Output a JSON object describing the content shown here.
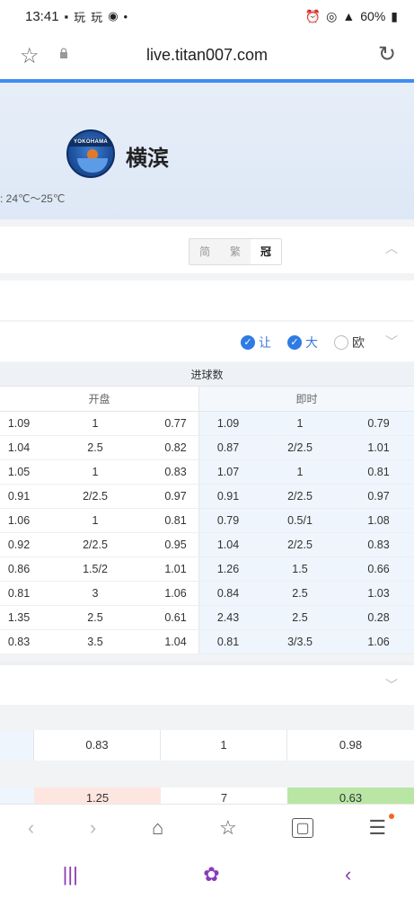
{
  "status": {
    "time": "13:41",
    "left_icons": [
      "■",
      "玩",
      "玩",
      "●",
      "•"
    ],
    "battery": "60%"
  },
  "browser": {
    "url": "live.titan007.com"
  },
  "team": {
    "name": "横滨",
    "weather": ": 24℃～25℃",
    "logo_text": "YOKOHAMA"
  },
  "lang": {
    "options": [
      "简",
      "繁",
      "冠"
    ],
    "active": "冠"
  },
  "filters": [
    {
      "label": "让",
      "checked": true
    },
    {
      "label": "大",
      "checked": true
    },
    {
      "label": "欧",
      "checked": false
    }
  ],
  "table": {
    "title": "进球数",
    "open_label": "开盘",
    "live_label": "即时",
    "rows": [
      [
        "1.09",
        "1",
        "0.77",
        "1.09",
        "1",
        "0.79"
      ],
      [
        "1.04",
        "2.5",
        "0.82",
        "0.87",
        "2/2.5",
        "1.01"
      ],
      [
        "1.05",
        "1",
        "0.83",
        "1.07",
        "1",
        "0.81"
      ],
      [
        "0.91",
        "2/2.5",
        "0.97",
        "0.91",
        "2/2.5",
        "0.97"
      ],
      [
        "1.06",
        "1",
        "0.81",
        "0.79",
        "0.5/1",
        "1.08"
      ],
      [
        "0.92",
        "2/2.5",
        "0.95",
        "1.04",
        "2/2.5",
        "0.83"
      ],
      [
        "0.86",
        "1.5/2",
        "1.01",
        "1.26",
        "1.5",
        "0.66"
      ],
      [
        "0.81",
        "3",
        "1.06",
        "0.84",
        "2.5",
        "1.03"
      ],
      [
        "1.35",
        "2.5",
        "0.61",
        "2.43",
        "2.5",
        "0.28"
      ],
      [
        "0.83",
        "3.5",
        "1.04",
        "0.81",
        "3/3.5",
        "1.06"
      ]
    ]
  },
  "section2": {
    "row_b": [
      "",
      "0.83",
      "1",
      "0.98"
    ],
    "row_c": [
      "",
      "1.25",
      "7",
      "0.63"
    ]
  },
  "colors": {
    "accent": "#3c8df0",
    "header_bg": "#dde8f6",
    "nav_purple": "#8a3bb8"
  }
}
